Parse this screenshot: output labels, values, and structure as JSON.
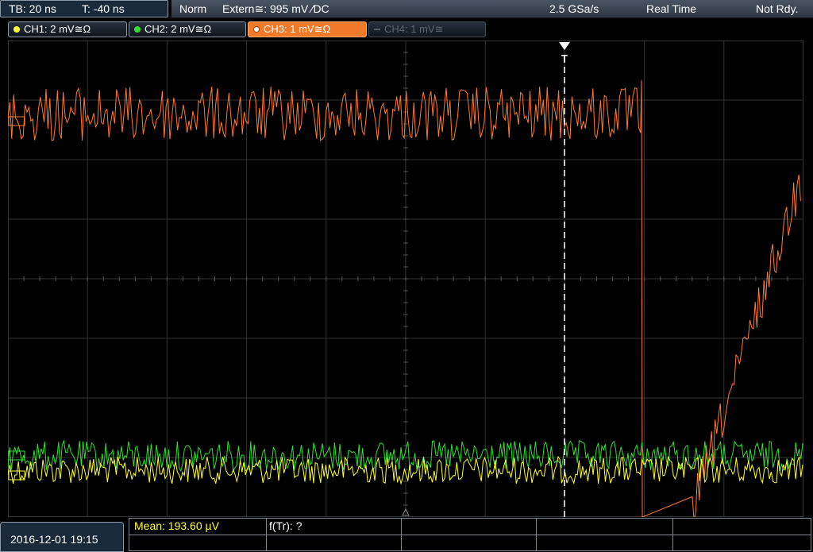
{
  "top": {
    "tb_label": "TB: 20 ns",
    "t_label": "T: -40 ns",
    "mode": "Norm",
    "trigger_source": "Extern≅: 995 mV ∕DC",
    "sample_rate": "2.5 GSa/s",
    "acq_mode": "Real Time",
    "status": "Not Rdy."
  },
  "channels": [
    {
      "label": "CH1: 2 mV≅Ω",
      "color": "#ffff33"
    },
    {
      "label": "CH2: 2 mV≅Ω",
      "color": "#33dd33"
    },
    {
      "label": "CH3: 1 mV≅Ω",
      "color": "#ff8030"
    },
    {
      "label": "CH4: 1 mV≅",
      "color": "#555c63"
    }
  ],
  "trigger_marker": "T",
  "bottom": {
    "datetime": "2016-12-01 19:15",
    "mean_label": "Mean: 193.60 µV",
    "ftr_label": "f(Tr): ?"
  },
  "colors": {
    "grid": "#3a3a3a",
    "ch1": "#ffff33",
    "ch2": "#33dd33",
    "ch3": "#ff7a30",
    "mean_text": "#ffff33"
  }
}
